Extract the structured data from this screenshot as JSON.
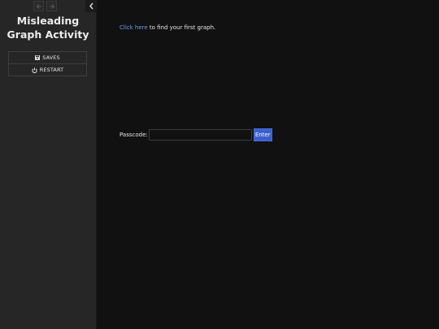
{
  "sidebar": {
    "story_title": "Misleading Graph Activity",
    "nav": {
      "back_icon": "arrow-left-icon",
      "forward_icon": "arrow-right-icon",
      "collapse_icon": "chevron-left-icon"
    },
    "menu": {
      "saves_label": "SAVES",
      "saves_icon": "save-icon",
      "restart_label": "RESTART",
      "restart_icon": "power-icon"
    }
  },
  "passage": {
    "link_text": "Click here",
    "text_after_link": " to find your first graph."
  },
  "passcode": {
    "label": "Passcode:",
    "value": "",
    "button_label": "Enter"
  },
  "colors": {
    "background": "#111111",
    "sidebar": "#262626",
    "link": "#6b9ff0",
    "button": "#3a5fcd"
  }
}
